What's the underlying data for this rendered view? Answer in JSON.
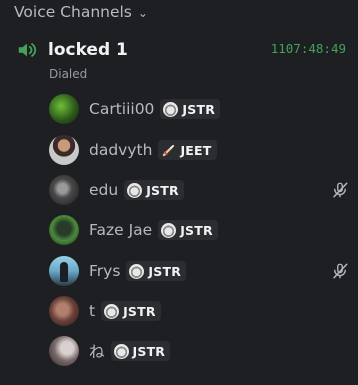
{
  "section": {
    "title": "Voice Channels",
    "icon": "chevron-down-icon"
  },
  "channel": {
    "name": "locked 1",
    "icon": "speaker-icon",
    "timer": "1107:48:49",
    "status": "Dialed",
    "accent": "#43a25a"
  },
  "users": [
    {
      "name": "Cartiii00",
      "tag": "JSTR",
      "tag_icon": "ring-icon",
      "muted": false
    },
    {
      "name": "dadvyth",
      "tag": "JEET",
      "tag_icon": "sword-icon",
      "muted": false
    },
    {
      "name": "edu",
      "tag": "JSTR",
      "tag_icon": "ring-icon",
      "muted": true
    },
    {
      "name": "Faze Jae",
      "tag": "JSTR",
      "tag_icon": "ring-icon",
      "muted": false
    },
    {
      "name": "Frys",
      "tag": "JSTR",
      "tag_icon": "ring-icon",
      "muted": true
    },
    {
      "name": "t",
      "tag": "JSTR",
      "tag_icon": "ring-icon",
      "muted": false
    },
    {
      "name": "ね",
      "tag": "JSTR",
      "tag_icon": "ring-icon",
      "muted": false
    }
  ]
}
